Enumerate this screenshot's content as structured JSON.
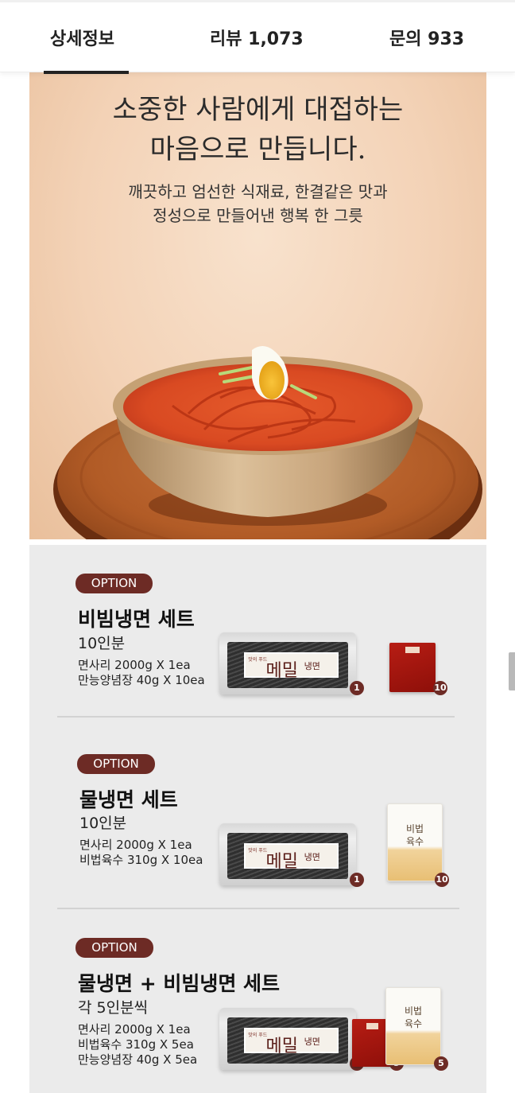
{
  "tabs": [
    {
      "label": "상세정보",
      "active": true
    },
    {
      "label": "리뷰 1,073",
      "active": false
    },
    {
      "label": "문의 933",
      "active": false
    }
  ],
  "hero": {
    "title_line1": "소중한 사람에게 대접하는",
    "title_line2": "마음으로 만듭니다.",
    "subtitle_line1": "깨끗하고 엄선한 식재료, 한결같은 맛과",
    "subtitle_line2": "정성으로 만들어낸 행복 한 그릇"
  },
  "options": [
    {
      "badge": "OPTION",
      "name": "비빔냉면 세트",
      "serving": "10인분",
      "lines": [
        "면사리 2000g X 1ea",
        "만능양념장 40g X 10ea"
      ],
      "qty": [
        "1",
        "10"
      ]
    },
    {
      "badge": "OPTION",
      "name": "물냉면 세트",
      "serving": "10인분",
      "lines": [
        "면사리 2000g X 1ea",
        "비법육수 310g  X 10ea"
      ],
      "qty": [
        "1",
        "10"
      ]
    },
    {
      "badge": "OPTION",
      "name": "물냉면 + 비빔냉면 세트",
      "serving": "각 5인분씩",
      "lines": [
        "면사리 2000g X 1ea",
        "비법육수  310g X 5ea",
        "만능양념장 40g X 5ea"
      ],
      "qty": [
        "1",
        "5",
        "5"
      ]
    }
  ],
  "package": {
    "brand": "맛의 푸드",
    "big": "메밀",
    "small": "냉면",
    "broth_line1": "비법",
    "broth_line2": "육수"
  },
  "colors": {
    "badge": "#6d2b25",
    "panel": "#ebebeb",
    "hero_bg": "#f3d2b6"
  }
}
